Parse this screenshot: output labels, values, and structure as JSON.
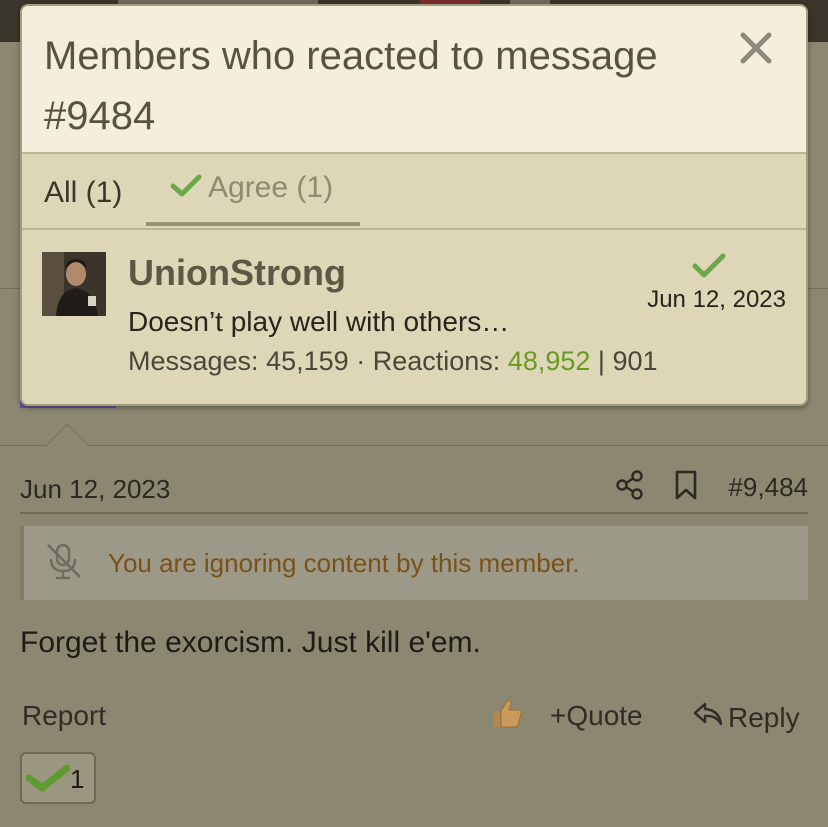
{
  "modal": {
    "title": "Members who reacted to message #9484",
    "close_icon": "close-icon",
    "tabs": [
      {
        "label": "All (1)",
        "active": false
      },
      {
        "label": "Agree (1)",
        "active": true,
        "icon": "check-icon"
      }
    ],
    "members": [
      {
        "username": "UnionStrong",
        "title": "Doesn’t play well with others…",
        "messages_label": "Messages:",
        "messages": "45,159",
        "separator": "·",
        "reactions_label": "Reactions:",
        "reactions_positive": "48,952",
        "pipe": "|",
        "reactions_other": "901",
        "date": "Jun 12, 2023",
        "reaction_icon": "check-icon"
      }
    ]
  },
  "post": {
    "date": "Jun 12, 2023",
    "number": "#9,484",
    "ignore_notice": "You are ignoring content by this member.",
    "body": "Forget the exorcism. Just kill e'em.",
    "actions": {
      "report": "Report",
      "quote": "+Quote",
      "reply": "Reply"
    },
    "reaction_count": "1"
  },
  "colors": {
    "accent_green": "#6a9a22",
    "modal_bg": "#ddd7b8",
    "header_bg": "#f3efdc",
    "ignore_text": "#7a5218"
  }
}
